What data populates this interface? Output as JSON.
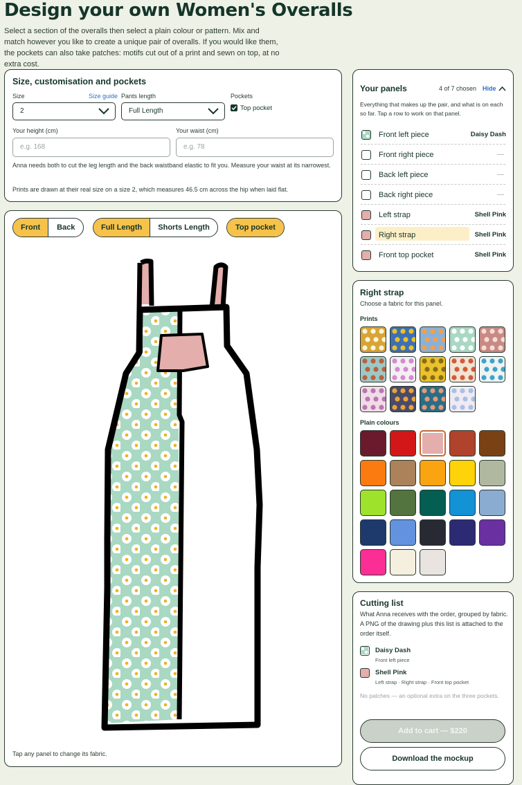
{
  "page": {
    "title": "Design your own Women's Overalls",
    "intro": "Select a section of the overalls then select a plain colour or pattern. Mix and match however you like to create a unique pair of overalls. If you would like them, the pockets can also take patches: motifs cut out of a print and sewn on top, at no extra cost."
  },
  "size_card": {
    "title": "Size, customisation and pockets",
    "size_label": "Size",
    "size_guide": "Size guide",
    "size_value": "2",
    "length_label": "Pants length",
    "length_value": "Full Length",
    "pockets_label": "Pockets",
    "pocket_option": "Top pocket",
    "pocket_checked": true,
    "height_label": "Your height (cm)",
    "height_placeholder": "e.g. 168",
    "waist_label": "Your waist (cm)",
    "waist_placeholder": "e.g. 78",
    "note1": "Anna needs both to cut the leg length and the back waistband elastic to fit you. Measure your waist at its narrowest.",
    "note2": "Prints are drawn at their real size on a size 2, which measures 46.5 cm across the hip when laid flat."
  },
  "preview": {
    "view_toggle": [
      "Front",
      "Back"
    ],
    "view_active": "Front",
    "length_toggle": [
      "Full Length",
      "Shorts Length"
    ],
    "length_active": "Full Length",
    "pocket_toggle": "Top pocket",
    "hint": "Tap any panel to change its fabric."
  },
  "panels": {
    "title": "Your panels",
    "count": "4 of 7 chosen",
    "hide": "Hide",
    "desc": "Everything that makes up the pair, and what is on each so far. Tap a row to work on that panel.",
    "rows": [
      {
        "name": "Front left piece",
        "fabric": "Daisy Dash",
        "swatch": "daisy"
      },
      {
        "name": "Front right piece",
        "fabric": "—",
        "swatch": "none"
      },
      {
        "name": "Back left piece",
        "fabric": "—",
        "swatch": "none"
      },
      {
        "name": "Back right piece",
        "fabric": "—",
        "swatch": "none"
      },
      {
        "name": "Left strap",
        "fabric": "Shell Pink",
        "swatch": "#e3aeab"
      },
      {
        "name": "Right strap",
        "fabric": "Shell Pink",
        "swatch": "#e3aeab"
      },
      {
        "name": "Front top pocket",
        "fabric": "Shell Pink",
        "swatch": "#e3aeab"
      }
    ],
    "selected": "Right strap"
  },
  "fabric_picker": {
    "title": "Right strap",
    "desc": "Choose a fabric for this panel.",
    "prints_label": "Prints",
    "prints": [
      {
        "bg": "#d8a437",
        "fg": "#fff4d8"
      },
      {
        "bg": "#3f6fb3",
        "fg": "#e9c12a"
      },
      {
        "bg": "#8bb1d9",
        "fg": "#f2a04a"
      },
      {
        "bg": "#a9d8c3",
        "fg": "#ffffff"
      },
      {
        "bg": "#c98a83",
        "fg": "#f7dcd6"
      },
      {
        "bg": "#9fc7c6",
        "fg": "#b7623e"
      },
      {
        "bg": "#f5eef3",
        "fg": "#d38bd0"
      },
      {
        "bg": "#e9c22c",
        "fg": "#8a6a18"
      },
      {
        "bg": "#f2e4d2",
        "fg": "#d45a3a"
      },
      {
        "bg": "#eef3f4",
        "fg": "#3fa3c8"
      },
      {
        "bg": "#f1dbe6",
        "fg": "#b877b2"
      },
      {
        "bg": "#4a4a6a",
        "fg": "#e8a43a"
      },
      {
        "bg": "#2b6d86",
        "fg": "#e39a78"
      },
      {
        "bg": "#f1eaf3",
        "fg": "#a7c1e3"
      }
    ],
    "plain_label": "Plain colours",
    "plain": [
      "#6b1a2e",
      "#d31618",
      "#e3aeab",
      "#b0432b",
      "#7a4115",
      "#fb7b10",
      "#ab825a",
      "#fba411",
      "#fed309",
      "#b0b9a0",
      "#9ee22c",
      "#53733f",
      "#045e52",
      "#1392d6",
      "#8aacd0",
      "#1e3a6c",
      "#6393df",
      "#282a33",
      "#2c2a73",
      "#6a30a1",
      "#fb2e95",
      "#f5efe0",
      "#e9e4e0"
    ],
    "plain_selected": 2
  },
  "cutting": {
    "title": "Cutting list",
    "desc": "What Anna receives with the order, grouped by fabric. A PNG of the drawing plus this list is attached to the order itself.",
    "items": [
      {
        "fabric": "Daisy Dash",
        "pieces": "Front left piece",
        "swatch": "daisy"
      },
      {
        "fabric": "Shell Pink",
        "pieces": "Left strap · Right strap · Front top pocket",
        "swatch": "#e3aeab"
      }
    ],
    "patch_note": "No patches — an optional extra on the three pockets.",
    "cart_label": "Add to cart — $220",
    "download_label": "Download the mockup"
  },
  "colors": {
    "accent": "#f6c24a",
    "ink": "#15352a",
    "daisy_bg": "#a9d8c3",
    "shell_pink": "#e3aeab",
    "cart_bg": "#c9d1c9"
  }
}
